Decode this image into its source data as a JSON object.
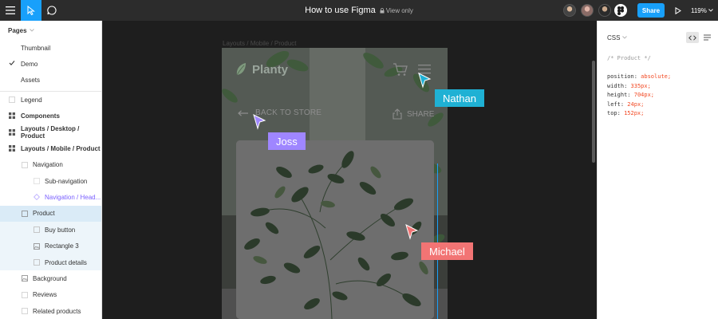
{
  "toolbar": {
    "title": "How to use Figma",
    "view_label": "View only",
    "share_label": "Share",
    "zoom": "119%"
  },
  "pages": {
    "heading": "Pages",
    "items": [
      {
        "label": "Thumbnail"
      },
      {
        "label": "Demo",
        "checked": true
      },
      {
        "label": "Assets"
      }
    ]
  },
  "layers": [
    {
      "label": "Legend"
    },
    {
      "label": "Components"
    },
    {
      "label": "Layouts / Desktop / Product"
    },
    {
      "label": "Layouts / Mobile / Product"
    },
    {
      "label": "Navigation"
    },
    {
      "label": "Sub-navigation"
    },
    {
      "label": "Navigation / Head..."
    },
    {
      "label": "Product"
    },
    {
      "label": "Buy button"
    },
    {
      "label": "Rectangle 3"
    },
    {
      "label": "Product details"
    },
    {
      "label": "Background"
    },
    {
      "label": "Reviews"
    },
    {
      "label": "Related products"
    }
  ],
  "canvas": {
    "frame_label": "Layouts / Mobile / Product",
    "brand": "Planty",
    "back_label": "BACK TO STORE",
    "share_label": "SHARE",
    "collaborators": [
      {
        "name": "Nathan",
        "color": "#1fb1d4"
      },
      {
        "name": "Joss",
        "color": "#9f86ff"
      },
      {
        "name": "Michael",
        "color": "#f27474"
      }
    ]
  },
  "inspect": {
    "heading": "CSS",
    "comment": "/* Product */",
    "props": [
      {
        "key": "position:",
        "value": "absolute;"
      },
      {
        "key": "width:",
        "value": "335px;"
      },
      {
        "key": "height:",
        "value": "704px;"
      },
      {
        "key": "left:",
        "value": "24px;"
      },
      {
        "key": "top:",
        "value": "152px;"
      }
    ]
  },
  "colors": {
    "accent": "#18a0fb",
    "selection": "#daebf7",
    "code_value": "#f24822",
    "component_purple": "#7b61ff"
  }
}
